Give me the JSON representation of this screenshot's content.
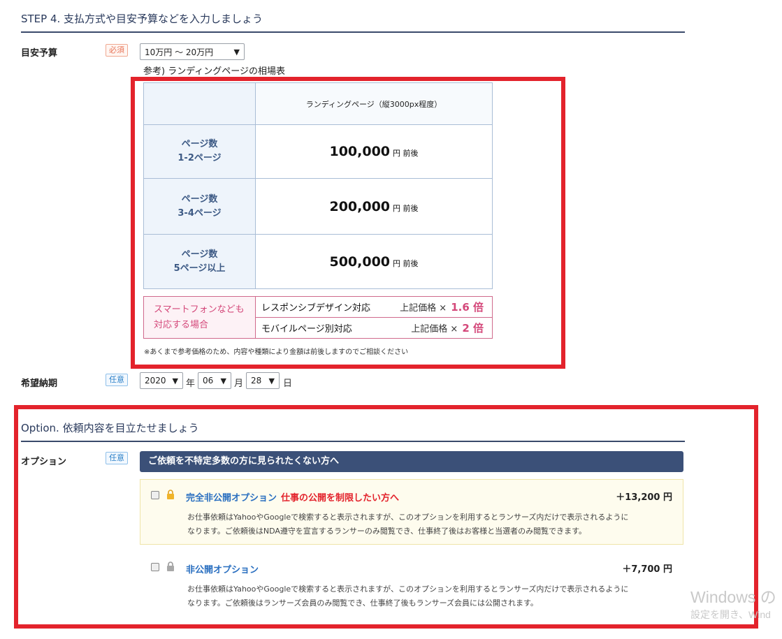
{
  "step4": {
    "title": "STEP 4. 支払方式や目安予算などを入力しましょう",
    "budget_label": "目安予算",
    "required_badge": "必須",
    "budget_select": "10万円 ～ 20万円",
    "reference_caption": "参考) ランディングページの相場表",
    "table": {
      "column_header": "ランディングページ（縦3000px程度）",
      "rows": [
        {
          "label_line1": "ページ数",
          "label_line2": "1-2ページ",
          "price": "100,000",
          "unit": "円 前後"
        },
        {
          "label_line1": "ページ数",
          "label_line2": "3-4ページ",
          "price": "200,000",
          "unit": "円 前後"
        },
        {
          "label_line1": "ページ数",
          "label_line2": "5ページ以上",
          "price": "500,000",
          "unit": "円 前後"
        }
      ],
      "smart_label_line1": "スマートフォンなども",
      "smart_label_line2": "対応する場合",
      "smart_rows": [
        {
          "name": "レスポンシブデザイン対応",
          "prefix": "上記価格 ×",
          "mult": "1.6 倍"
        },
        {
          "name": "モバイルページ別対応",
          "prefix": "上記価格 ×",
          "mult": "2 倍"
        }
      ],
      "note": "※あくまで参考価格のため、内容や種類により金額は前後しますのでご相談ください"
    },
    "deadline_label": "希望納期",
    "optional_badge": "任意",
    "year": "2020",
    "year_unit": "年",
    "month": "06",
    "month_unit": "月",
    "day": "28",
    "day_unit": "日"
  },
  "option": {
    "title": "Option. 依頼内容を目立たせましょう",
    "label": "オプション",
    "optional_badge": "任意",
    "bar_text": "ご依頼を不特定多数の方に見られたくない方へ",
    "items": [
      {
        "name": "完全非公開オプション",
        "subtitle": "仕事の公開を制限したい方へ",
        "price": "＋13,200 円",
        "desc_line1": "お仕事依頼はYahooやGoogleで検索すると表示されますが、このオプションを利用するとランサーズ内だけで表示されるように",
        "desc_line2": "なります。ご依頼後はNDA遵守を宣言するランサーのみ閲覧でき、仕事終了後はお客様と当選者のみ閲覧できます。"
      },
      {
        "name": "非公開オプション",
        "price": "＋7,700 円",
        "desc_line1": "お仕事依頼はYahooやGoogleで検索すると表示されますが、このオプションを利用するとランサーズ内だけで表示されるように",
        "desc_line2": "なります。ご依頼後はランサーズ会員のみ閲覧でき、仕事終了後もランサーズ会員には公開されます。"
      }
    ]
  },
  "watermark": {
    "line1": "Windows の",
    "line2": "設定を開き、Wind"
  },
  "colors": {
    "highlight": "#e3232c",
    "navy_bar": "#3b5078",
    "option_link": "#2a6fc0"
  }
}
